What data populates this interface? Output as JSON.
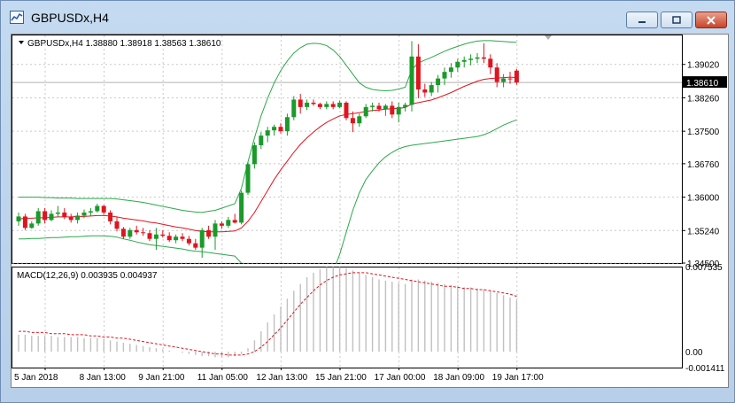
{
  "window": {
    "title": "GBPUSDx,H4",
    "minimize_label": "minimize",
    "maximize_label": "maximize",
    "close_label": "close"
  },
  "chart_data": [
    {
      "type": "candlestick",
      "symbol_info": "GBPUSDx,H4  1.38880 1.38918 1.38563 1.38610",
      "current_price_label": "1.38610",
      "current_price": 1.3861,
      "ylim": [
        1.345,
        1.397
      ],
      "y_ticks": [
        "1.39020",
        "1.38260",
        "1.37500",
        "1.36760",
        "1.36000",
        "1.35240",
        "1.34500"
      ],
      "y_tick_values": [
        1.3902,
        1.3826,
        1.375,
        1.3676,
        1.36,
        1.3524,
        1.345
      ],
      "x_ticks": [
        "5 Jan 2018",
        "8 Jan 13:00",
        "9 Jan 21:00",
        "11 Jan 05:00",
        "12 Jan 13:00",
        "15 Jan 21:00",
        "17 Jan 00:00",
        "18 Jan 09:00",
        "19 Jan 17:00"
      ],
      "x_tick_indices": [
        0,
        9,
        18,
        27,
        36,
        45,
        54,
        63,
        72
      ],
      "grid": true,
      "bullish_color": "#1a9a2a",
      "bearish_color": "#e0141e",
      "ma_color": "#e0141e",
      "bands_color": "#2aa84a",
      "candles": [
        [
          1.3545,
          1.3565,
          1.3535,
          1.3556
        ],
        [
          1.3556,
          1.3562,
          1.3525,
          1.353
        ],
        [
          1.353,
          1.3545,
          1.3528,
          1.354
        ],
        [
          1.354,
          1.3575,
          1.3535,
          1.3568
        ],
        [
          1.3568,
          1.3575,
          1.354,
          1.3548
        ],
        [
          1.3548,
          1.357,
          1.3545,
          1.3562
        ],
        [
          1.3562,
          1.358,
          1.3555,
          1.3565
        ],
        [
          1.3565,
          1.3575,
          1.355,
          1.3555
        ],
        [
          1.3555,
          1.3562,
          1.3542,
          1.3548
        ],
        [
          1.3548,
          1.3565,
          1.354,
          1.3558
        ],
        [
          1.3558,
          1.3572,
          1.3552,
          1.3565
        ],
        [
          1.3565,
          1.3575,
          1.3558,
          1.3568
        ],
        [
          1.3568,
          1.3585,
          1.3565,
          1.358
        ],
        [
          1.358,
          1.3582,
          1.356,
          1.3565
        ],
        [
          1.3565,
          1.357,
          1.3538,
          1.3545
        ],
        [
          1.3545,
          1.3555,
          1.3522,
          1.3528
        ],
        [
          1.3528,
          1.3532,
          1.3505,
          1.351
        ],
        [
          1.351,
          1.353,
          1.3505,
          1.3525
        ],
        [
          1.3525,
          1.3535,
          1.3515,
          1.352
        ],
        [
          1.352,
          1.353,
          1.3512,
          1.3518
        ],
        [
          1.3518,
          1.3525,
          1.35,
          1.3505
        ],
        [
          1.3505,
          1.353,
          1.348,
          1.3515
        ],
        [
          1.3515,
          1.3525,
          1.3508,
          1.3512
        ],
        [
          1.3512,
          1.352,
          1.3498,
          1.3502
        ],
        [
          1.3502,
          1.3515,
          1.3495,
          1.351
        ],
        [
          1.351,
          1.3518,
          1.35,
          1.3505
        ],
        [
          1.3505,
          1.3512,
          1.349,
          1.3495
        ],
        [
          1.3495,
          1.3505,
          1.348,
          1.3485
        ],
        [
          1.3485,
          1.353,
          1.3462,
          1.3525
        ],
        [
          1.3525,
          1.3535,
          1.3505,
          1.351
        ],
        [
          1.351,
          1.3548,
          1.348,
          1.354
        ],
        [
          1.354,
          1.3545,
          1.3528,
          1.3535
        ],
        [
          1.3535,
          1.3555,
          1.353,
          1.3548
        ],
        [
          1.3548,
          1.3562,
          1.354,
          1.3542
        ],
        [
          1.3542,
          1.3615,
          1.3538,
          1.361
        ],
        [
          1.361,
          1.368,
          1.3605,
          1.3675
        ],
        [
          1.3675,
          1.3725,
          1.3665,
          1.3718
        ],
        [
          1.3718,
          1.3748,
          1.371,
          1.374
        ],
        [
          1.374,
          1.376,
          1.3725,
          1.3752
        ],
        [
          1.3752,
          1.3765,
          1.374,
          1.376
        ],
        [
          1.376,
          1.3768,
          1.3745,
          1.375
        ],
        [
          1.375,
          1.379,
          1.374,
          1.3782
        ],
        [
          1.3782,
          1.383,
          1.3775,
          1.3822
        ],
        [
          1.3822,
          1.3835,
          1.379,
          1.3805
        ],
        [
          1.3805,
          1.3822,
          1.3798,
          1.3815
        ],
        [
          1.3815,
          1.3822,
          1.3808,
          1.3812
        ],
        [
          1.3812,
          1.3815,
          1.38,
          1.3805
        ],
        [
          1.3805,
          1.3818,
          1.38,
          1.3812
        ],
        [
          1.3812,
          1.3818,
          1.38,
          1.3805
        ],
        [
          1.3805,
          1.382,
          1.3802,
          1.3815
        ],
        [
          1.3815,
          1.3818,
          1.3775,
          1.378
        ],
        [
          1.378,
          1.3795,
          1.3748,
          1.3768
        ],
        [
          1.3768,
          1.379,
          1.376,
          1.3784
        ],
        [
          1.3784,
          1.3812,
          1.378,
          1.3805
        ],
        [
          1.3805,
          1.3815,
          1.3795,
          1.3808
        ],
        [
          1.3808,
          1.3815,
          1.3795,
          1.38
        ],
        [
          1.38,
          1.3812,
          1.3785,
          1.3808
        ],
        [
          1.3808,
          1.3818,
          1.378,
          1.3788
        ],
        [
          1.3788,
          1.3815,
          1.377,
          1.3805
        ],
        [
          1.3805,
          1.3815,
          1.3795,
          1.381
        ],
        [
          1.381,
          1.3955,
          1.3795,
          1.392
        ],
        [
          1.392,
          1.3948,
          1.3825,
          1.3845
        ],
        [
          1.3845,
          1.3858,
          1.3828,
          1.3838
        ],
        [
          1.3838,
          1.3862,
          1.383,
          1.3855
        ],
        [
          1.3855,
          1.3878,
          1.3838,
          1.387
        ],
        [
          1.387,
          1.3895,
          1.3855,
          1.3885
        ],
        [
          1.3885,
          1.3905,
          1.3872,
          1.3895
        ],
        [
          1.3895,
          1.3915,
          1.3885,
          1.3908
        ],
        [
          1.3908,
          1.392,
          1.3895,
          1.3912
        ],
        [
          1.3912,
          1.3925,
          1.39,
          1.3915
        ],
        [
          1.3915,
          1.3928,
          1.3905,
          1.3918
        ],
        [
          1.3918,
          1.395,
          1.3905,
          1.3915
        ],
        [
          1.3915,
          1.3925,
          1.388,
          1.3895
        ],
        [
          1.3895,
          1.3905,
          1.385,
          1.3862
        ],
        [
          1.3862,
          1.388,
          1.385,
          1.387
        ],
        [
          1.387,
          1.3885,
          1.3858,
          1.3868
        ],
        [
          1.3888,
          1.3892,
          1.3856,
          1.3861
        ]
      ],
      "ma": [
        1.355,
        1.3552,
        1.3552,
        1.3553,
        1.3553,
        1.3554,
        1.3555,
        1.3555,
        1.3555,
        1.3556,
        1.3556,
        1.3557,
        1.3558,
        1.3558,
        1.3557,
        1.3555,
        1.3552,
        1.355,
        1.3548,
        1.3546,
        1.3543,
        1.3541,
        1.3538,
        1.3535,
        1.3532,
        1.353,
        1.3527,
        1.3524,
        1.3522,
        1.3521,
        1.3521,
        1.3521,
        1.3522,
        1.3523,
        1.353,
        1.3545,
        1.3565,
        1.359,
        1.3615,
        1.364,
        1.3662,
        1.3682,
        1.3702,
        1.372,
        1.3735,
        1.3748,
        1.376,
        1.377,
        1.3778,
        1.3785,
        1.3788,
        1.379,
        1.3792,
        1.3795,
        1.3797,
        1.3798,
        1.38,
        1.3801,
        1.3802,
        1.3804,
        1.3812,
        1.3815,
        1.3818,
        1.3821,
        1.3826,
        1.3832,
        1.3838,
        1.3845,
        1.3852,
        1.3858,
        1.3864,
        1.3868,
        1.387,
        1.3871,
        1.3872,
        1.3873,
        1.3872
      ],
      "bb_upper": [
        1.36,
        1.36,
        1.36,
        1.36,
        1.3599,
        1.3599,
        1.3598,
        1.3598,
        1.3598,
        1.3597,
        1.3597,
        1.3597,
        1.3597,
        1.3597,
        1.3597,
        1.3596,
        1.3594,
        1.3592,
        1.359,
        1.3588,
        1.3585,
        1.3582,
        1.3579,
        1.3576,
        1.3573,
        1.357,
        1.3568,
        1.3566,
        1.3565,
        1.3568,
        1.357,
        1.3575,
        1.358,
        1.3585,
        1.362,
        1.368,
        1.3735,
        1.3785,
        1.3825,
        1.386,
        1.3888,
        1.391,
        1.3928,
        1.394,
        1.3948,
        1.395,
        1.3949,
        1.3945,
        1.3935,
        1.392,
        1.39,
        1.388,
        1.386,
        1.385,
        1.3845,
        1.3843,
        1.3842,
        1.3843,
        1.3846,
        1.385,
        1.389,
        1.3905,
        1.3912,
        1.3918,
        1.3925,
        1.3932,
        1.3938,
        1.3943,
        1.3948,
        1.3952,
        1.3955,
        1.3956,
        1.3956,
        1.3955,
        1.3954,
        1.3953,
        1.3952
      ],
      "bb_lower": [
        1.3505,
        1.3505,
        1.3506,
        1.3506,
        1.3507,
        1.3508,
        1.3508,
        1.3509,
        1.351,
        1.351,
        1.3511,
        1.3512,
        1.3512,
        1.3512,
        1.3511,
        1.3509,
        1.3505,
        1.3502,
        1.3498,
        1.3495,
        1.3492,
        1.349,
        1.3488,
        1.3486,
        1.3484,
        1.3482,
        1.3479,
        1.3477,
        1.3476,
        1.3474,
        1.3472,
        1.347,
        1.3468,
        1.3466,
        1.345,
        1.342,
        1.339,
        1.336,
        1.334,
        1.332,
        1.33,
        1.329,
        1.3285,
        1.329,
        1.3305,
        1.333,
        1.336,
        1.3395,
        1.343,
        1.347,
        1.352,
        1.357,
        1.361,
        1.364,
        1.366,
        1.3678,
        1.3692,
        1.3702,
        1.371,
        1.3715,
        1.3718,
        1.372,
        1.3722,
        1.3724,
        1.3726,
        1.3728,
        1.373,
        1.3732,
        1.3734,
        1.3736,
        1.3738,
        1.3742,
        1.3748,
        1.3756,
        1.3764,
        1.377,
        1.3776
      ]
    },
    {
      "type": "macd",
      "label": "MACD(12,26,9) 0.003935 0.004937",
      "ylim": [
        -0.00141,
        0.00754
      ],
      "y_ticks": [
        "0.007535",
        "0.00",
        "-0.001411"
      ],
      "y_tick_values": [
        0.00753,
        0.0,
        -0.00141
      ],
      "histogram_color": "#c0c0c0",
      "signal_color": "#e0141e",
      "histogram": [
        0.0015,
        0.0015,
        0.0014,
        0.0014,
        0.0014,
        0.0014,
        0.0013,
        0.0013,
        0.0013,
        0.0013,
        0.0012,
        0.0012,
        0.0012,
        0.0011,
        0.001,
        0.0009,
        0.0008,
        0.0007,
        0.0006,
        0.0005,
        0.0004,
        0.0003,
        0.0002,
        0.0001,
        0.0,
        -0.0001,
        -0.0002,
        -0.0003,
        -0.0004,
        -0.0004,
        -0.0005,
        -0.0005,
        -0.0005,
        -0.0004,
        -0.0002,
        0.0003,
        0.001,
        0.0018,
        0.0026,
        0.0033,
        0.004,
        0.0047,
        0.0054,
        0.006,
        0.0066,
        0.007,
        0.0073,
        0.0075,
        0.0075,
        0.0075,
        0.0074,
        0.0072,
        0.007,
        0.0068,
        0.0066,
        0.0064,
        0.0063,
        0.0062,
        0.0061,
        0.006,
        0.0064,
        0.0064,
        0.0063,
        0.0062,
        0.0061,
        0.006,
        0.0059,
        0.0058,
        0.0057,
        0.0057,
        0.0056,
        0.0055,
        0.0054,
        0.0052,
        0.005,
        0.0048,
        0.0046
      ],
      "signal": [
        0.0018,
        0.0018,
        0.0017,
        0.0017,
        0.0017,
        0.0016,
        0.0016,
        0.0016,
        0.0015,
        0.0015,
        0.0015,
        0.0014,
        0.0014,
        0.0013,
        0.0013,
        0.0012,
        0.0012,
        0.0011,
        0.001,
        0.0009,
        0.0008,
        0.0007,
        0.0006,
        0.0005,
        0.0004,
        0.0003,
        0.0002,
        0.0001,
        0.0,
        -0.0001,
        -0.0002,
        -0.0002,
        -0.0003,
        -0.0003,
        -0.0003,
        -0.0002,
        0.0,
        0.0004,
        0.0009,
        0.0015,
        0.0021,
        0.0028,
        0.0035,
        0.0042,
        0.0048,
        0.0054,
        0.0059,
        0.0063,
        0.0066,
        0.0068,
        0.0069,
        0.007,
        0.007,
        0.007,
        0.0069,
        0.0068,
        0.0067,
        0.0066,
        0.0065,
        0.0064,
        0.0063,
        0.0062,
        0.0061,
        0.006,
        0.0059,
        0.0058,
        0.0058,
        0.0057,
        0.0056,
        0.0056,
        0.0055,
        0.0055,
        0.0054,
        0.0053,
        0.0052,
        0.0051,
        0.0049
      ]
    }
  ]
}
